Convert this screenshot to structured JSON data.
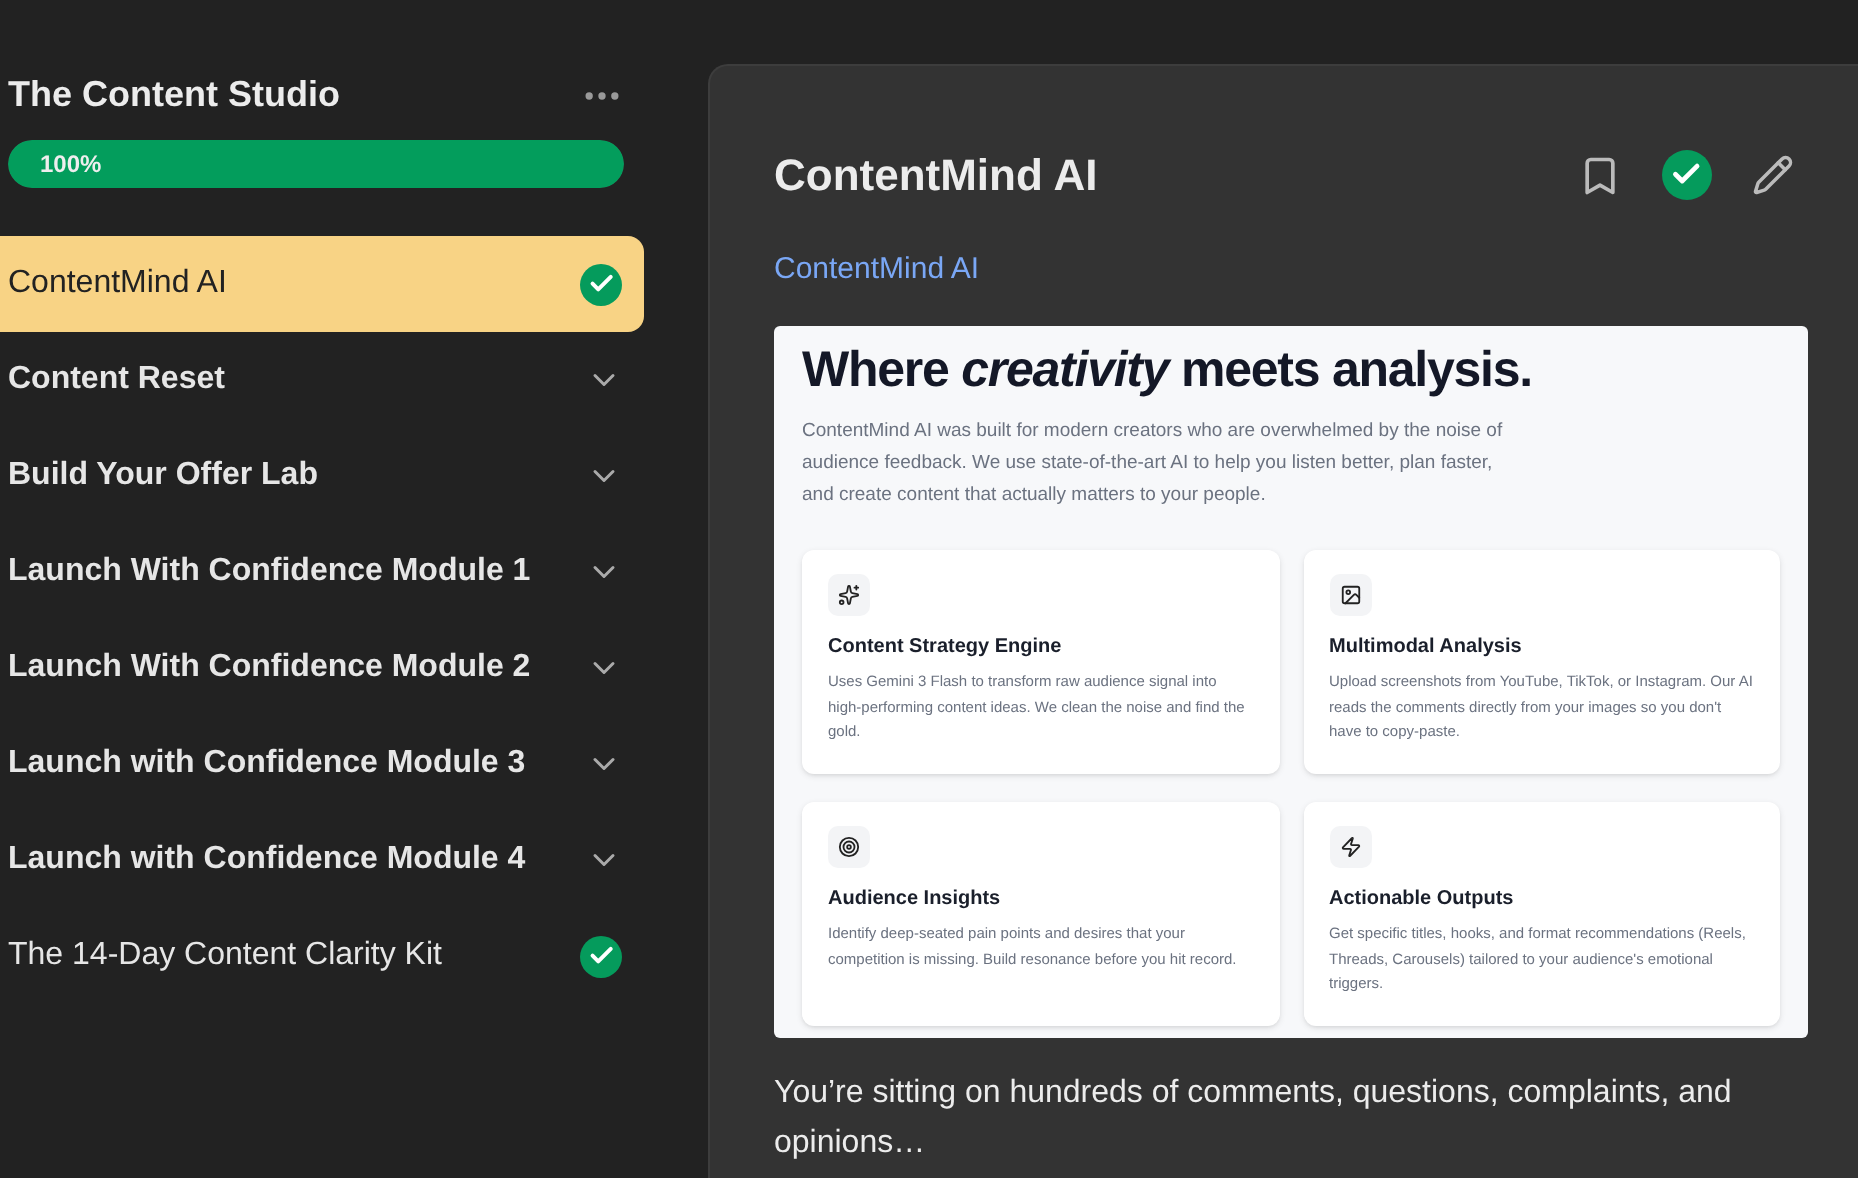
{
  "sidebar": {
    "title": "The Content Studio",
    "progress": {
      "level": 1,
      "label": "100%"
    },
    "items": [
      {
        "kind": "lesson",
        "label": "ContentMind AI",
        "selected": true,
        "completed": true
      },
      {
        "kind": "module",
        "label": "Content Reset",
        "selected": false,
        "expanded": false
      },
      {
        "kind": "module",
        "label": "Build Your Offer Lab",
        "selected": false,
        "expanded": false
      },
      {
        "kind": "module",
        "label": "Launch With Confidence Module 1",
        "selected": false,
        "expanded": false
      },
      {
        "kind": "module",
        "label": "Launch With Confidence Module 2",
        "selected": false,
        "expanded": false
      },
      {
        "kind": "module",
        "label": "Launch with Confidence Module 3",
        "selected": false,
        "expanded": false
      },
      {
        "kind": "module",
        "label": "Launch with Confidence Module 4",
        "selected": false,
        "expanded": false
      },
      {
        "kind": "lesson",
        "label": "The 14-Day Content Clarity Kit",
        "selected": false,
        "completed": true
      }
    ]
  },
  "lesson": {
    "title": "ContentMind AI",
    "completed": true,
    "link": "ContentMind AI",
    "embed": {
      "headline": "Where *creativity* meets analysis.",
      "intro": "ContentMind AI was built for modern creators who are overwhelmed by the noise of audience feedback. We use state-of-the-art AI to help you listen better, plan faster, and create content that actually matters to your people.",
      "features": [
        {
          "kind": "sparkles",
          "title": "Content Strategy Engine",
          "text": "Uses Gemini 3 Flash to transform raw audience signal into high-performing content ideas. We clean the noise and find the gold."
        },
        {
          "kind": "image",
          "title": "Multimodal Analysis",
          "text": "Upload screenshots from YouTube, TikTok, or Instagram. Our AI reads the comments directly from your images so you don't have to copy-paste."
        },
        {
          "kind": "target",
          "title": "Audience Insights",
          "text": "Identify deep-seated pain points and desires that your competition is missing. Build resonance before you hit record."
        },
        {
          "kind": "zap",
          "title": "Actionable Outputs",
          "text": "Get specific titles, hooks, and format recommendations (Reels, Threads, Carousels) tailored to your audience's emotional triggers."
        }
      ]
    },
    "body": "You’re sitting on hundreds of comments, questions, complaints, and opinions…"
  }
}
